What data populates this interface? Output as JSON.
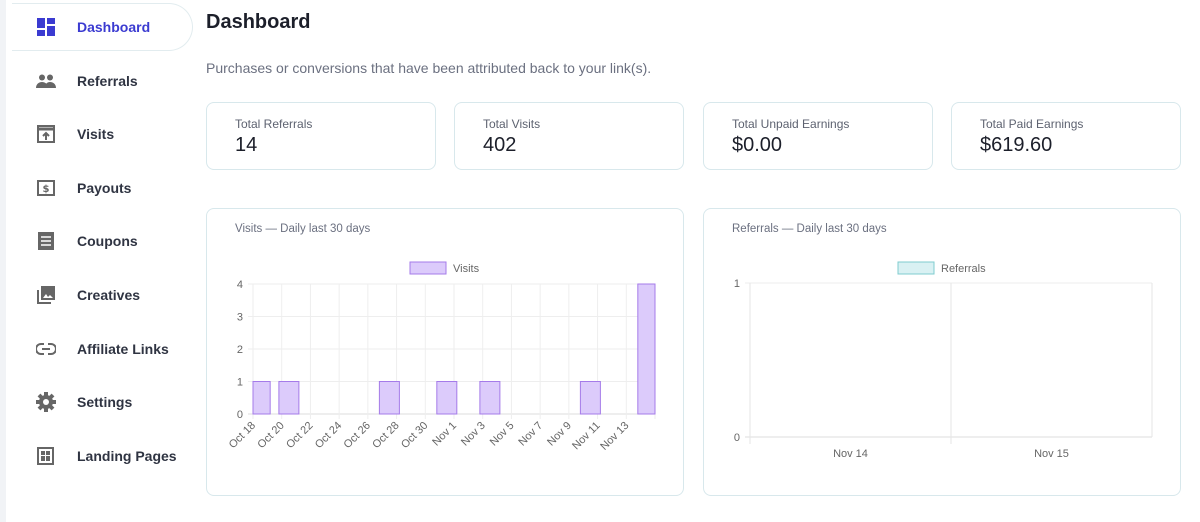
{
  "sidebar": {
    "items": [
      {
        "label": "Dashboard",
        "icon": "dashboard-icon",
        "active": true
      },
      {
        "label": "Referrals",
        "icon": "people-icon"
      },
      {
        "label": "Visits",
        "icon": "visits-icon"
      },
      {
        "label": "Payouts",
        "icon": "dollar-icon"
      },
      {
        "label": "Coupons",
        "icon": "coupon-icon"
      },
      {
        "label": "Creatives",
        "icon": "image-icon"
      },
      {
        "label": "Affiliate Links",
        "icon": "link-icon"
      },
      {
        "label": "Settings",
        "icon": "gear-icon"
      },
      {
        "label": "Landing Pages",
        "icon": "landing-page-icon"
      }
    ]
  },
  "header": {
    "title": "Dashboard",
    "subtitle": "Purchases or conversions that have been attributed back to your link(s)."
  },
  "stats": [
    {
      "label": "Total Referrals",
      "value": "14"
    },
    {
      "label": "Total Visits",
      "value": "402"
    },
    {
      "label": "Total Unpaid Earnings",
      "value": "$0.00"
    },
    {
      "label": "Total Paid Earnings",
      "value": "$619.60"
    }
  ],
  "colors": {
    "accent": "#3b3bd1",
    "visits_fill": "#dccbfb",
    "visits_stroke": "#a57be9",
    "referrals_fill": "#d9f1f3",
    "referrals_stroke": "#7fcccf"
  },
  "chart_data": [
    {
      "type": "bar",
      "title": "Visits — Daily last 30 days",
      "legend": "Visits",
      "legend_position": "top",
      "x_tick_labels": [
        "Oct 18",
        "Oct 20",
        "Oct 22",
        "Oct 24",
        "Oct 26",
        "Oct 28",
        "Oct 30",
        "Nov 1",
        "Nov 3",
        "Nov 5",
        "Nov 7",
        "Nov 9",
        "Nov 11",
        "Nov 13"
      ],
      "x": [
        "Oct 18",
        "Oct 19",
        "Oct 20",
        "Oct 21",
        "Oct 22",
        "Oct 23",
        "Oct 24",
        "Oct 25",
        "Oct 26",
        "Oct 27",
        "Oct 28",
        "Oct 29",
        "Oct 30",
        "Oct 31",
        "Nov 1",
        "Nov 2",
        "Nov 3",
        "Nov 4",
        "Nov 5",
        "Nov 6",
        "Nov 7",
        "Nov 8",
        "Nov 9",
        "Nov 10",
        "Nov 11",
        "Nov 12",
        "Nov 13",
        "Nov 14"
      ],
      "values": [
        1,
        0,
        1,
        0,
        0,
        0,
        0,
        0,
        0,
        1,
        0,
        0,
        0,
        1,
        0,
        0,
        1,
        0,
        0,
        0,
        0,
        0,
        0,
        1,
        0,
        0,
        0,
        4
      ],
      "ylim": [
        0,
        4
      ],
      "y_ticks": [
        "0",
        "1",
        "2",
        "3",
        "4"
      ],
      "grid": true
    },
    {
      "type": "bar",
      "title": "Referrals — Daily last 30 days",
      "legend": "Referrals",
      "legend_position": "top",
      "x": [
        "Nov 14",
        "Nov 15"
      ],
      "values": [
        0,
        0
      ],
      "ylim": [
        0,
        1
      ],
      "y_ticks": [
        "0",
        "1"
      ],
      "grid": true
    }
  ]
}
